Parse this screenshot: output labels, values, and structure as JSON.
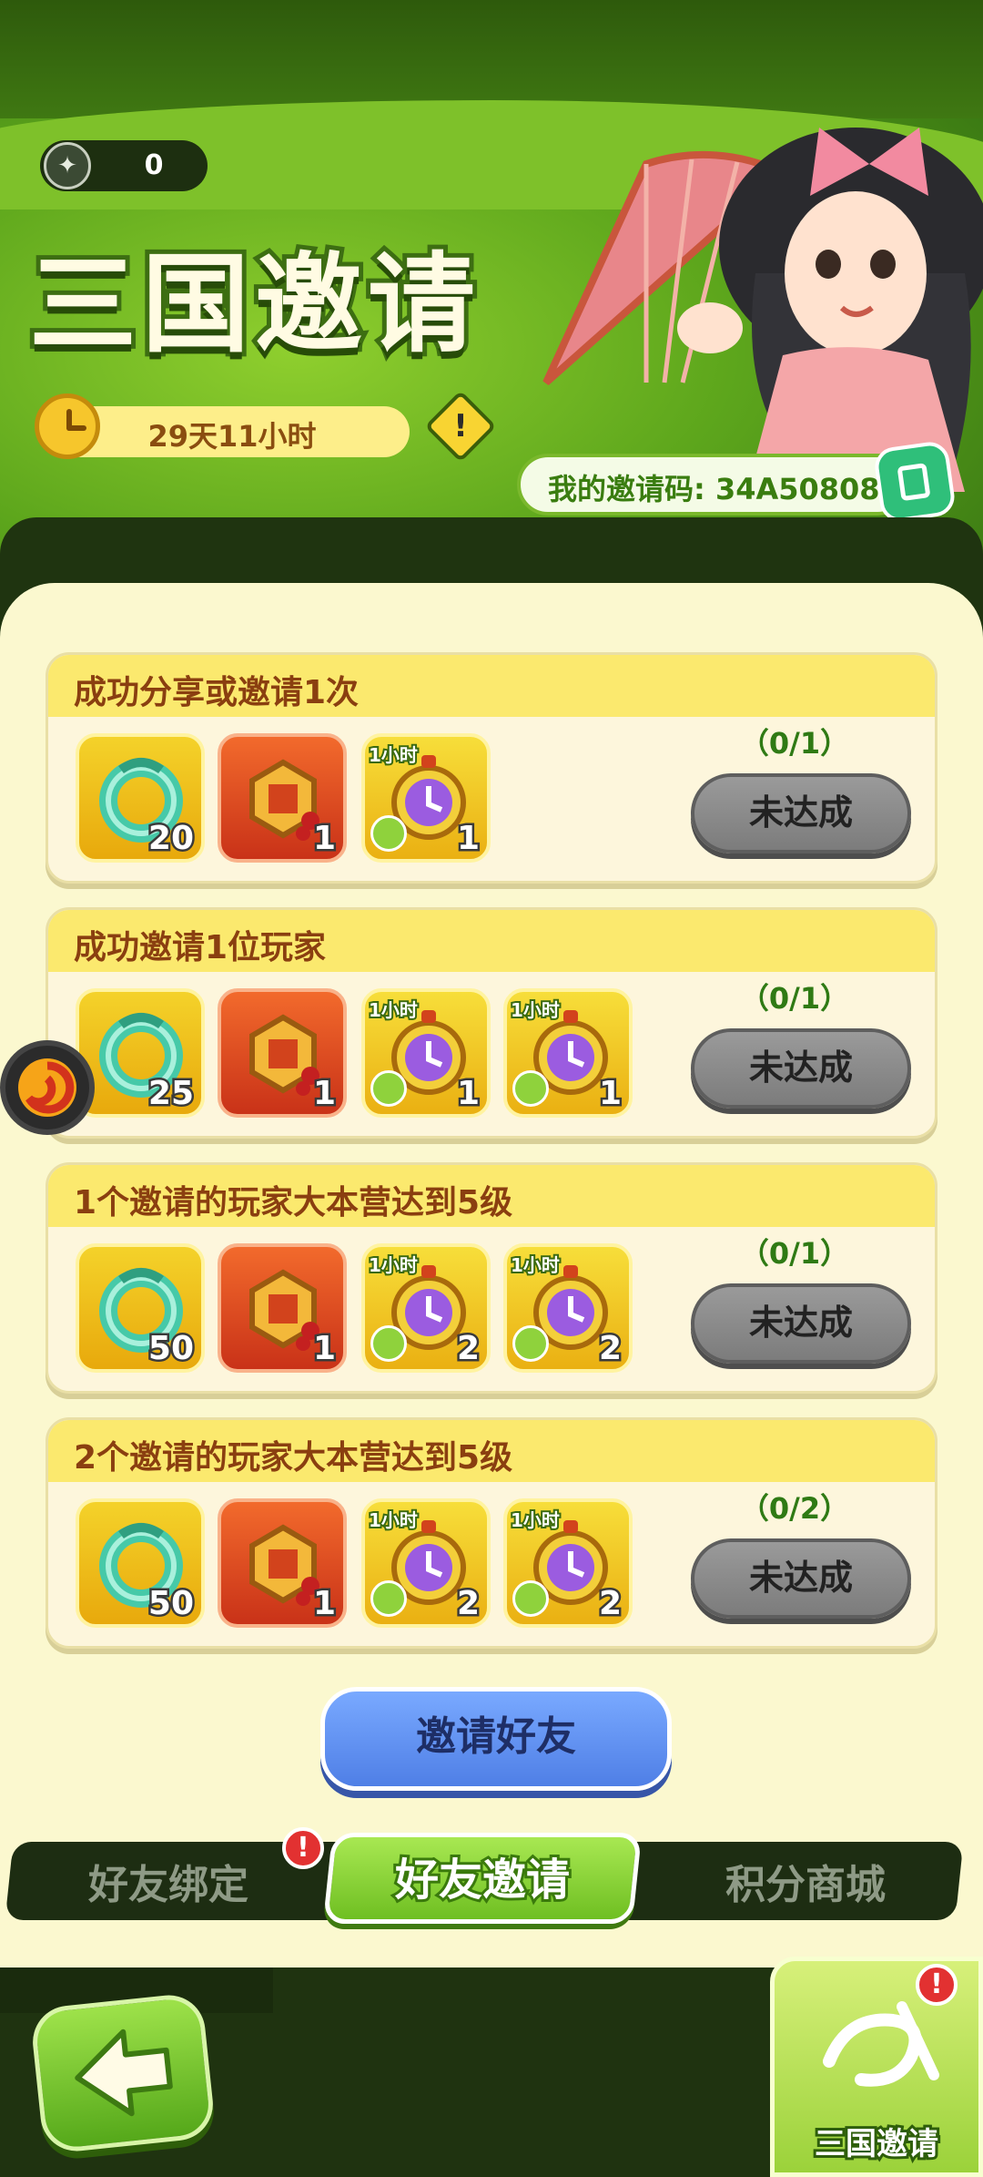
{
  "header": {
    "coin_count": "0",
    "title": "三国邀请",
    "timer": "29天11小时",
    "invite_code_label": "我的邀请码: 34A50808"
  },
  "tasks": [
    {
      "title": "成功分享或邀请1次",
      "progress": "（0/1）",
      "status": "未达成",
      "rewards": [
        {
          "type": "jade",
          "qty": "20"
        },
        {
          "type": "badge",
          "qty": "1"
        },
        {
          "type": "clock",
          "tag": "1小时",
          "qty": "1"
        }
      ]
    },
    {
      "title": "成功邀请1位玩家",
      "progress": "（0/1）",
      "status": "未达成",
      "rewards": [
        {
          "type": "jade",
          "qty": "25"
        },
        {
          "type": "badge",
          "qty": "1"
        },
        {
          "type": "clock",
          "tag": "1小时",
          "qty": "1"
        },
        {
          "type": "clock",
          "tag": "1小时",
          "qty": "1"
        }
      ]
    },
    {
      "title": "1个邀请的玩家大本营达到5级",
      "progress": "（0/1）",
      "status": "未达成",
      "rewards": [
        {
          "type": "jade",
          "qty": "50"
        },
        {
          "type": "badge",
          "qty": "1"
        },
        {
          "type": "clock",
          "tag": "1小时",
          "qty": "2"
        },
        {
          "type": "clock",
          "tag": "1小时",
          "qty": "2"
        }
      ]
    },
    {
      "title": "2个邀请的玩家大本营达到5级",
      "progress": "（0/2）",
      "status": "未达成",
      "rewards": [
        {
          "type": "jade",
          "qty": "50"
        },
        {
          "type": "badge",
          "qty": "1"
        },
        {
          "type": "clock",
          "tag": "1小时",
          "qty": "2"
        },
        {
          "type": "clock",
          "tag": "1小时",
          "qty": "2"
        }
      ]
    }
  ],
  "invite_button": "邀请好友",
  "tabs": {
    "bind": "好友绑定",
    "invite": "好友邀请",
    "shop": "积分商城",
    "alert_mark": "!"
  },
  "side_tab": {
    "label": "三国邀请",
    "alert_mark": "!"
  },
  "colors": {
    "accent_green": "#6fbf22",
    "header_yellow": "#fbe96e",
    "button_grey": "#8a8a8a",
    "invite_blue": "#5f8ff0"
  }
}
